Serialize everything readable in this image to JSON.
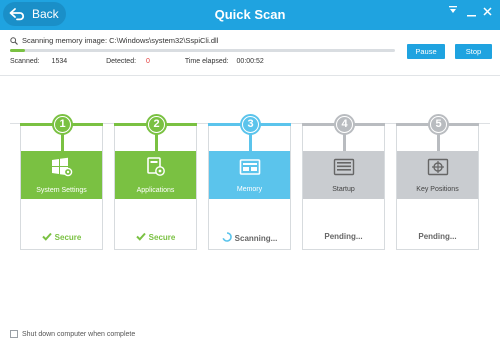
{
  "window": {
    "title": "Quick Scan",
    "back_label": "Back",
    "accent": "#1fa3e0"
  },
  "scan": {
    "prefix": "Scanning memory image:",
    "path": "C:\\Windows\\system32\\SspiCli.dll",
    "progress": 0.04,
    "pause_label": "Pause",
    "stop_label": "Stop"
  },
  "stats": {
    "scanned_label": "Scanned:",
    "scanned_value": "1534",
    "detected_label": "Detected:",
    "detected_value": "0",
    "elapsed_label": "Time elapsed:",
    "elapsed_value": "00:00:52"
  },
  "steps": [
    {
      "number": "1",
      "label": "System Settings",
      "status": "Secure",
      "icon": "windows-settings-icon",
      "color": "#7ac142",
      "state": "secure"
    },
    {
      "number": "2",
      "label": "Applications",
      "status": "Secure",
      "icon": "applications-icon",
      "color": "#7ac142",
      "state": "secure"
    },
    {
      "number": "3",
      "label": "Memory",
      "status": "Scanning...",
      "icon": "memory-icon",
      "color": "#5bc4ec",
      "state": "scanning"
    },
    {
      "number": "4",
      "label": "Startup",
      "status": "Pending...",
      "icon": "startup-icon",
      "color": "#b9bcc0",
      "state": "pending"
    },
    {
      "number": "5",
      "label": "Key Positions",
      "status": "Pending...",
      "icon": "key-positions-icon",
      "color": "#b9bcc0",
      "state": "pending"
    }
  ],
  "footer": {
    "shutdown_label": "Shut down computer when complete",
    "shutdown_checked": false
  }
}
